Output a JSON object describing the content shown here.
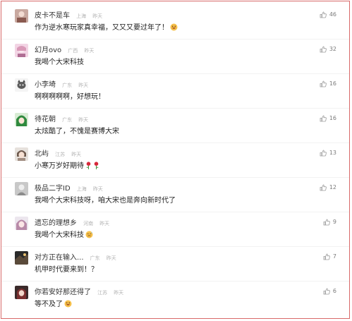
{
  "comments": [
    {
      "user": "皮卡不是车",
      "location": "上海",
      "time": "昨天",
      "text": "作为逆水寒玩家真幸福，又又又要过年了！",
      "emoji": "grin-emoji",
      "likes": "46"
    },
    {
      "user": "幻月ovo",
      "location": "广西",
      "time": "昨天",
      "text": "我喝个大宋科技",
      "emoji": "",
      "likes": "32"
    },
    {
      "user": "小李埼",
      "location": "广东",
      "time": "昨天",
      "text": "啊啊啊啊啊，好想玩！",
      "emoji": "",
      "likes": "16"
    },
    {
      "user": "待花朝",
      "location": "广东",
      "time": "昨天",
      "text": "太炫酷了，不愧是赛博大宋",
      "emoji": "",
      "likes": "16"
    },
    {
      "user": "北屿",
      "location": "江苏",
      "time": "昨天",
      "text": "小寒万岁好期待",
      "emoji": "rose-emoji",
      "likes": "13"
    },
    {
      "user": "极品二字ID",
      "location": "上海",
      "time": "昨天",
      "text": "我喝个大宋科技呀，咱大宋也是奔向新时代了",
      "emoji": "",
      "likes": "12"
    },
    {
      "user": "遗忘的理想乡",
      "location": "河南",
      "time": "昨天",
      "text": "我喝个大宋科技",
      "emoji": "sweat-emoji",
      "likes": "9"
    },
    {
      "user": "对方正在输入...",
      "location": "广东",
      "time": "昨天",
      "text": "机甲时代要来到！？",
      "emoji": "",
      "likes": "7"
    },
    {
      "user": "你若安好那还得了",
      "location": "江苏",
      "time": "昨天",
      "text": "等不及了",
      "emoji": "grin-emoji",
      "likes": "6"
    }
  ],
  "colors": {
    "border": "#d86a6a",
    "username": "#333333",
    "meta": "#b2b2b2",
    "text": "#1f1f1f",
    "likes": "#7a7a7a"
  }
}
